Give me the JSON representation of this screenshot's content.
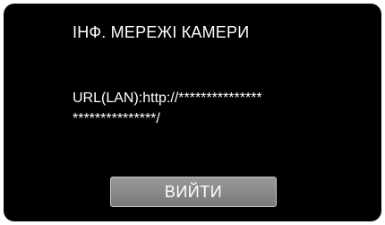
{
  "screen": {
    "title": "ІНФ. МЕРЕЖІ КАМЕРИ",
    "url_line1": "URL(LAN):http://***************",
    "url_line2": "***************/",
    "exit_label": "ВИЙТИ"
  },
  "colors": {
    "background": "#000000",
    "text": "#ffffff",
    "button": "#8a8a8a"
  }
}
